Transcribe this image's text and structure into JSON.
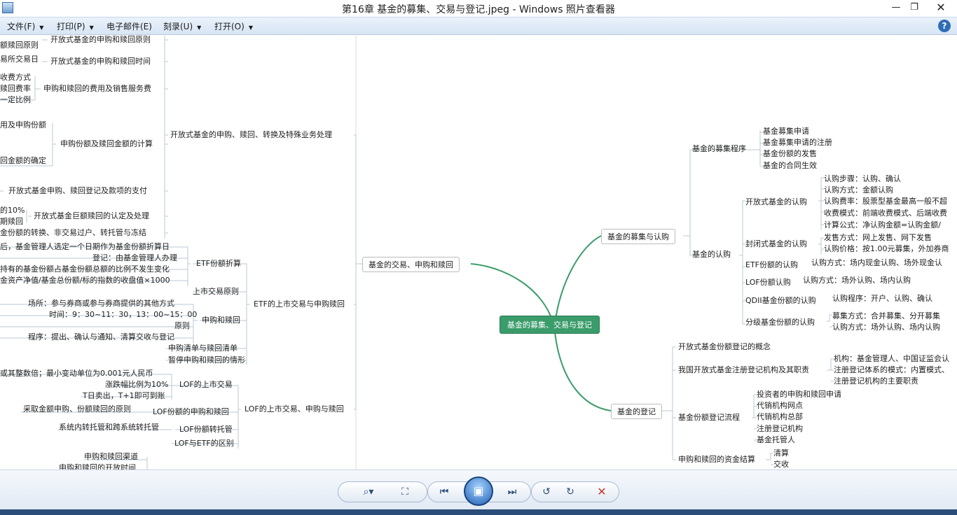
{
  "window": {
    "title": "第16章  基金的募集、交易与登记.jpeg - Windows 照片查看器",
    "min_glyph": "—",
    "max_glyph": "❐",
    "close_glyph": "✕"
  },
  "menu": {
    "items": [
      {
        "label": "文件(F)",
        "has_arrow": true
      },
      {
        "label": "打印(P)",
        "has_arrow": true
      },
      {
        "label": "电子邮件(E)",
        "has_arrow": false
      },
      {
        "label": "刻录(U)",
        "has_arrow": true
      },
      {
        "label": "打开(O)",
        "has_arrow": true
      }
    ],
    "arrow_glyph": "▼",
    "help_glyph": "?"
  },
  "mindmap": {
    "central": "基金的募集、交易与登记",
    "branches": {
      "left_top": "基金的交易、申购和赎回",
      "right_top": "基金的募集与认购",
      "right_bottom": "基金的登记"
    },
    "right": {
      "recruit_procedure": "基金的募集程序",
      "recruit_items": [
        "基金募集申请",
        "基金募集申请的注册",
        "基金份额的发售",
        "基金的合同生效"
      ],
      "subscription": "基金的认购",
      "open_sub": "开放式基金的认购",
      "open_sub_items": [
        "认购步骤：认购、确认",
        "认购方式：金额认购",
        "认购费率：股票型基金最高一般不超",
        "收费模式：前端收费模式、后端收费",
        "计算公式：净认购金额=认购金额/"
      ],
      "closed_sub": "封闭式基金的认购",
      "closed_sub_items": [
        "发售方式：网上发售、网下发售",
        "认购价格：按1.00元募集，外加券商"
      ],
      "etf_sub": "ETF份额的认购",
      "etf_sub_item": "认购方式：场内现金认购、场外现金认",
      "lof_sub": "LOF份额认购",
      "lof_sub_item": "认购方式：场外认购、场内认购",
      "qdii_sub": "QDII基金份额的认购",
      "qdii_sub_item": "认购程序：开户、认购、确认",
      "graded_sub": "分级基金份额的认购",
      "graded_sub_items": [
        "募集方式：合并募集、分开募集",
        "认购方式：场外认购、场内认购"
      ],
      "reg_concept": "开放式基金份额登记的概念",
      "reg_org": "我国开放式基金注册登记机构及其职责",
      "reg_org_items": [
        "机构：基金管理人、中国证监会认",
        "注册登记体系的模式：内置模式、",
        "注册登记机构的主要职责"
      ],
      "reg_flow": "基金份额登记流程",
      "reg_flow_items": [
        "投资者的申购和赎回申请",
        "代销机构网点",
        "代销机构总部",
        "注册登记机构",
        "基金托管人"
      ],
      "settle": "申购和赎回的资金结算",
      "settle_items": [
        "清算",
        "交收"
      ]
    },
    "left": {
      "open_trade": "开放式基金的申购、赎回、转换及特殊业务处理",
      "etf_trade": "ETF的上市交易与申购赎回",
      "lof_trade": "LOF的上市交易、申购与赎回",
      "l2_principle": "开放式基金的申购和赎回原则",
      "l2_principle_leaf": "额赎回原则",
      "l2_time": "开放式基金的申购和赎回时间",
      "l2_time_leaf": "易所交易日",
      "l2_fee": "申购和赎回的费用及销售服务费",
      "l2_fee_leaves": [
        "收费方式",
        "赎回费率",
        "一定比例"
      ],
      "l2_calc": "申购份额及赎回金额的计算",
      "l2_calc_leaves": [
        "用及申购份额",
        "回金额的确定"
      ],
      "l2_settle": "开放式基金申购、赎回登记及款项的支付",
      "l2_huge": "开放式基金巨额赎回的认定及处理",
      "l2_huge_leaves": [
        "的10%",
        "期赎回"
      ],
      "l2_transfer": "金份额的转换、非交易过户、转托管与冻结",
      "etf_split": "ETF份额折算",
      "etf_split_leaves": [
        "后，基金管理人选定一个日期作为基金份额折算日",
        "登记：由基金管理人办理",
        "持有的基金份额占基金份额总额的比例不发生变化",
        "金资产净值/基金总份额/标的指数的收盘值×1000"
      ],
      "etf_listing": "上市交易原则",
      "etf_sr": "申购和赎回",
      "etf_sr_leaves": [
        "场所：参与券商或参与券商提供的其他方式",
        "时间：9：30~11：30，13：00~15：00",
        "原则",
        "程序：提出、确认与通知、清算交收与登记"
      ],
      "etf_list": "申购清单与赎回清单",
      "etf_pause": "暂停申购和赎回的情形",
      "lof_market_leaf": "或其整数倍；最小变动单位为0.001元人民币",
      "lof_limit": "涨跌幅比例为10%",
      "lof_listing": "LOF的上市交易",
      "lof_t1": "T日卖出，T+1即可到账",
      "lof_sr": "LOF份额的申购和赎回",
      "lof_sr_leaf": "采取金额申购、份额赎回的原则",
      "lof_transfer": "LOF份额转托管",
      "lof_transfer_leaf": "系统内转托管和跨系统转托管",
      "lof_diff": "LOF与ETF的区别",
      "lof_channel": "申购和赎回渠道",
      "lof_open_time": "申购和赎回的开放时间"
    }
  },
  "toolbar": {
    "zoom": "⌕▾",
    "fit": "⛶",
    "prev": "⏮",
    "slideshow": "▣",
    "next": "⏭",
    "rotate_ccw": "↺",
    "rotate_cw": "↻",
    "delete": "✕"
  },
  "colors": {
    "central": "#3a9c6a",
    "branch_line": "#3a9c6a",
    "delete": "#c0392b"
  }
}
